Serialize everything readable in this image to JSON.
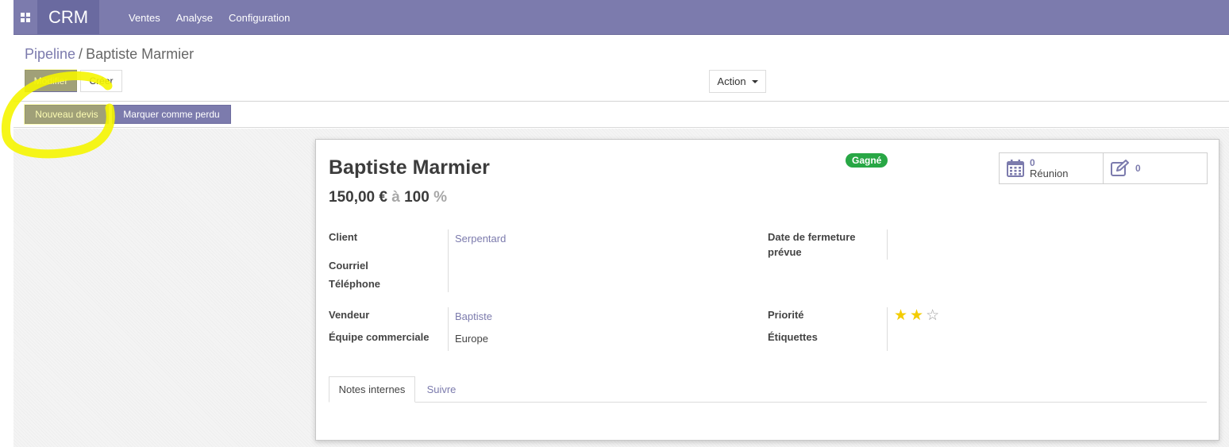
{
  "navbar": {
    "brand": "CRM",
    "menu": [
      "Ventes",
      "Analyse",
      "Configuration"
    ]
  },
  "breadcrumb": {
    "parent": "Pipeline",
    "separator": "/",
    "current": "Baptiste Marmier"
  },
  "buttons": {
    "edit": "Modifier",
    "create": "Créer",
    "action": "Action"
  },
  "statusbar": {
    "new_quote": "Nouveau devis",
    "mark_lost": "Marquer comme perdu"
  },
  "record": {
    "name": "Baptiste Marmier",
    "revenue": "150,00 €",
    "at": "à",
    "probability": "100",
    "percent": "%",
    "status_badge": "Gagné"
  },
  "smart_buttons": {
    "meetings_count": "0",
    "meetings_label": "Réunion",
    "notes_count": "0"
  },
  "fields": {
    "client_label": "Client",
    "client_value": "Serpentard",
    "email_label": "Courriel",
    "phone_label": "Téléphone",
    "deadline_label_line1": "Date de fermeture",
    "deadline_label_line2": "prévue",
    "salesperson_label": "Vendeur",
    "salesperson_value": "Baptiste",
    "team_label": "Équipe commerciale",
    "team_value": "Europe",
    "priority_label": "Priorité",
    "priority_stars": 2,
    "priority_max": 3,
    "tags_label": "Étiquettes"
  },
  "tabs": [
    "Notes internes",
    "Suivre"
  ],
  "colors": {
    "brand": "#7c7bad",
    "success": "#28a745",
    "star": "#f3cc00",
    "highlight": "#f5f500"
  }
}
